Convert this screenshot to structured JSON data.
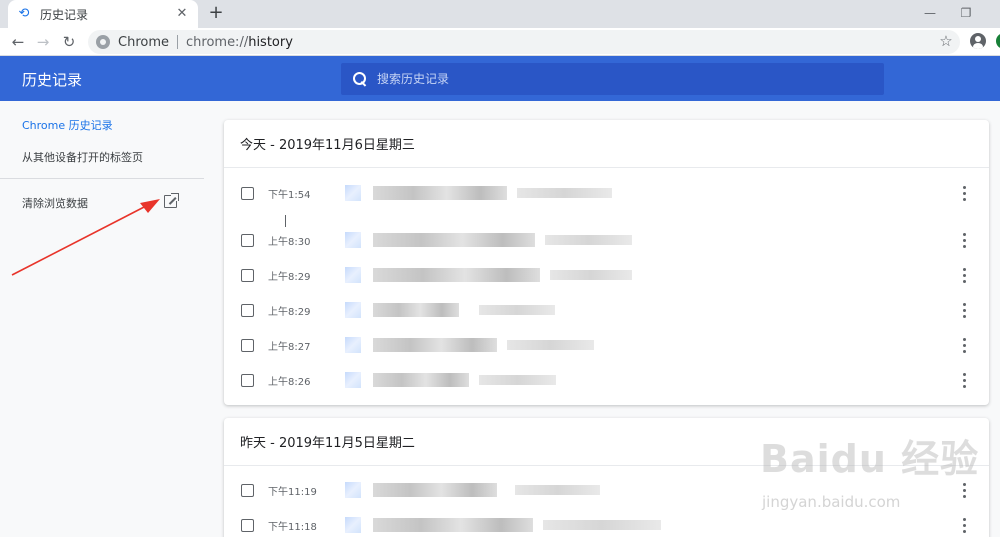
{
  "browser": {
    "tab_title": "历史记录",
    "tab_close": "✕",
    "new_tab": "+",
    "back": "←",
    "forward": "→",
    "reload": "↻",
    "site_label": "Chrome",
    "url_scheme": "chrome://",
    "url_path": "history",
    "bookmark_star": "☆"
  },
  "header": {
    "title": "历史记录",
    "search_placeholder": "搜索历史记录"
  },
  "sidebar": {
    "items": [
      {
        "label": "Chrome 历史记录",
        "active": true
      },
      {
        "label": "从其他设备打开的标签页",
        "active": false
      },
      {
        "label": "清除浏览数据",
        "active": false
      }
    ]
  },
  "groups": [
    {
      "title": "今天 - 2019年11月6日星期三",
      "entries": [
        {
          "time": "下午1:54"
        },
        {
          "time": "上午8:30"
        },
        {
          "time": "上午8:29"
        },
        {
          "time": "上午8:29"
        },
        {
          "time": "上午8:27"
        },
        {
          "time": "上午8:26"
        }
      ]
    },
    {
      "title": "昨天 - 2019年11月5日星期二",
      "entries": [
        {
          "time": "下午11:19"
        },
        {
          "time": "下午11:18"
        }
      ]
    }
  ],
  "watermark": {
    "brand": "Baidu 经验",
    "url": "jingyan.baidu.com"
  },
  "colors": {
    "header_bg": "#3367d6",
    "search_bg": "#2a56c6",
    "active_link": "#1a73e8",
    "annotation_arrow": "#e8342a"
  }
}
